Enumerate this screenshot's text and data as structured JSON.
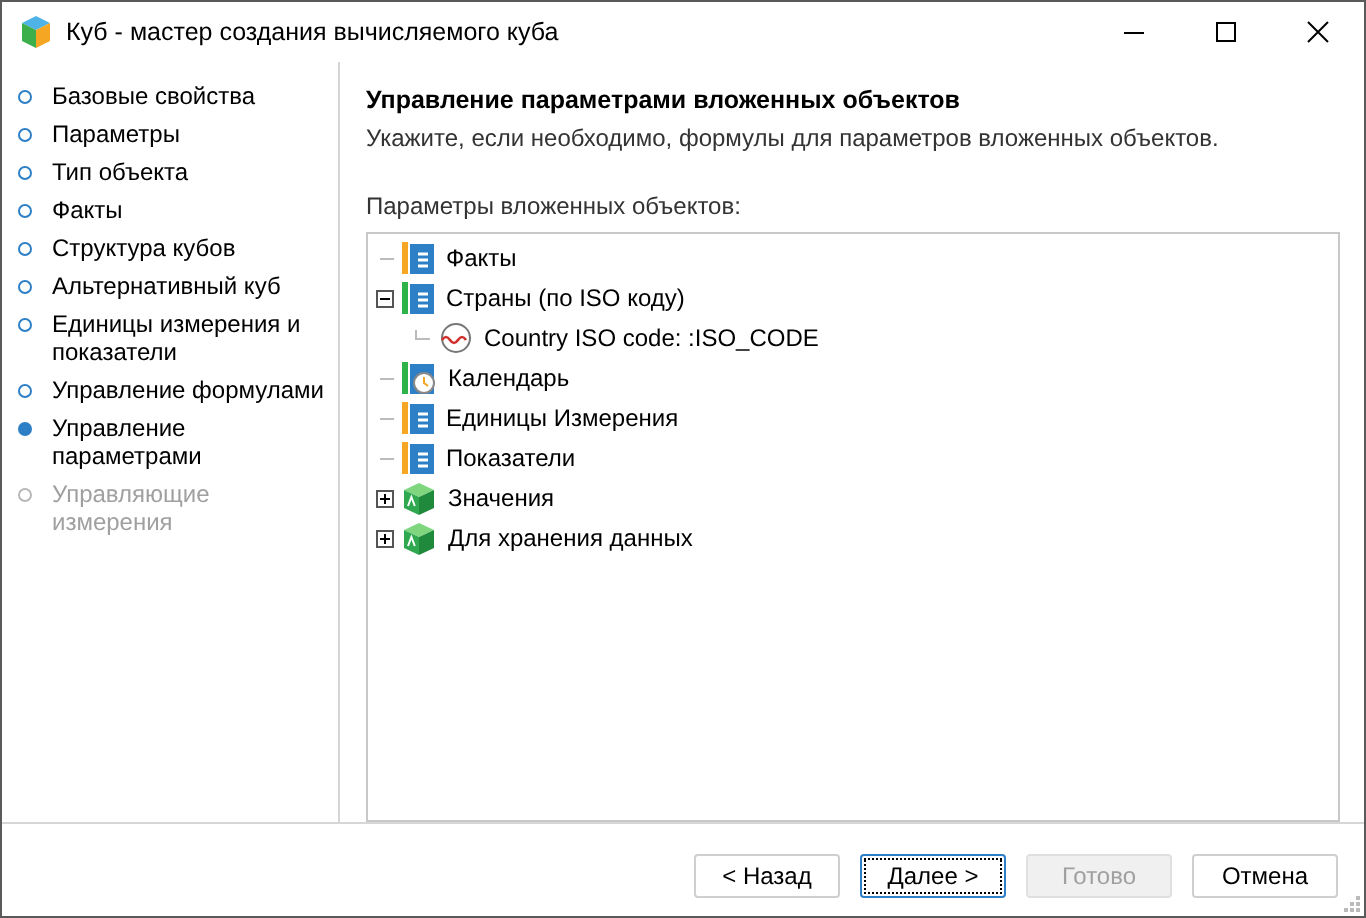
{
  "window": {
    "title": "Куб - мастер создания вычисляемого куба"
  },
  "steps": [
    {
      "label": "Базовые свойства",
      "selected": false,
      "disabled": false
    },
    {
      "label": "Параметры",
      "selected": false,
      "disabled": false
    },
    {
      "label": "Тип объекта",
      "selected": false,
      "disabled": false
    },
    {
      "label": "Факты",
      "selected": false,
      "disabled": false
    },
    {
      "label": "Структура кубов",
      "selected": false,
      "disabled": false
    },
    {
      "label": "Альтернативный куб",
      "selected": false,
      "disabled": false
    },
    {
      "label": "Единицы измерения и показатели",
      "selected": false,
      "disabled": false
    },
    {
      "label": "Управление формулами",
      "selected": false,
      "disabled": false
    },
    {
      "label": "Управление параметрами",
      "selected": true,
      "disabled": false
    },
    {
      "label": "Управляющие измерения",
      "selected": false,
      "disabled": true
    }
  ],
  "page": {
    "heading": "Управление параметрами вложенных объектов",
    "description": "Укажите, если необходимо, формулы для параметров вложенных объектов.",
    "tree_label": "Параметры вложенных объектов:"
  },
  "tree": [
    {
      "label": "Факты",
      "kind": "dimension",
      "color": "#f5a623"
    },
    {
      "label": "Страны (по ISO коду)",
      "kind": "dimension",
      "color": "#2db34a",
      "expanded": true,
      "children": [
        {
          "label": "Country ISO code: :ISO_CODE",
          "kind": "attribute"
        }
      ]
    },
    {
      "label": "Календарь",
      "kind": "calendar",
      "color": "#2db34a"
    },
    {
      "label": "Единицы Измерения",
      "kind": "dimension",
      "color": "#f5a623"
    },
    {
      "label": "Показатели",
      "kind": "dimension",
      "color": "#f5a623"
    },
    {
      "label": "Значения",
      "kind": "cube",
      "expanded": false
    },
    {
      "label": "Для хранения данных",
      "kind": "cube",
      "expanded": false
    }
  ],
  "buttons": [
    {
      "label": "< Назад",
      "disabled": false,
      "focused": false
    },
    {
      "label": "Далее >",
      "disabled": false,
      "focused": true
    },
    {
      "label": "Готово",
      "disabled": true,
      "focused": false
    },
    {
      "label": "Отмена",
      "disabled": false,
      "focused": false
    }
  ]
}
